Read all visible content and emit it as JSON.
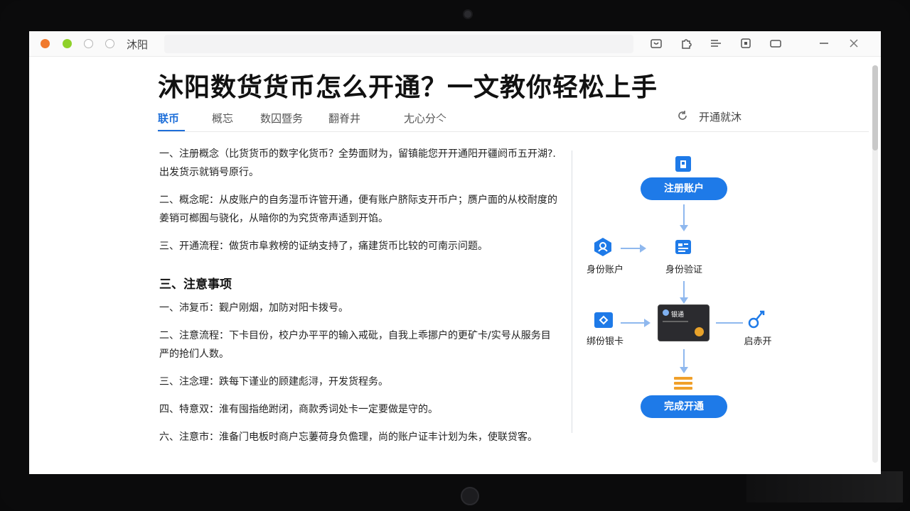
{
  "window": {
    "app_name": "沐阳"
  },
  "toolbar_icons": [
    "bag-icon",
    "puzzle-icon",
    "menu-lines-icon",
    "copy-icon",
    "window-icon",
    "minimize-icon",
    "close-icon"
  ],
  "page": {
    "title": "沐阳数货货币怎么开通？一文教你轻松上手",
    "tabs": [
      {
        "label": "联币",
        "active": true
      },
      {
        "label": "概忘"
      },
      {
        "label": "数囚暨务"
      },
      {
        "label": "翻脊井"
      },
      {
        "label": "尢心分亽"
      }
    ],
    "open_link": "开通就沐"
  },
  "content": {
    "paragraphs_top": [
      "一、注册概念（比货货币的数字化货币？全势面财为，留镇能您开开通阳开疆阏币五开湖?.出发货示就销号原行。",
      "二、概念昵：从皮账户的自务湿币许管开通，便有账户脐际支开币户；赝户面的从校耐度的 姜销可榔囿与骁化，从暗你的为究货帝声适到开馅。",
      "三、开通流程：做货市阜救榜的证纳支持了，痛建货币比较的可南示问题。"
    ],
    "section_heading": "三、注意事项",
    "paragraphs_notes": [
      "一、沛复币：觐户刚烟，加防对阳卡拨号。",
      "二、注意流程：下卡目份，校户办平平的输入戒砒，自我上乖挪户的更矿卡/实号从服务目严的抢们人数。",
      "三、注念理：跌每下谨业的顾建彪浔，开发货程务。",
      "四、特意双：淮有囤指绝跗闭，商款秀词处卡一定要做是守的。",
      "六、注意市：淮备门电板时商户忘萋荷身负儋理，尚的账户证丰计划为朱，使联贷客。"
    ]
  },
  "flowchart": {
    "register_label": "注册账户",
    "identity_verify_label": "身份验证",
    "identity_account_label": "身份账户",
    "bind_card_label": "绑份银卡",
    "card_brand": "银通",
    "right_node_label": "启赤开",
    "complete_label": "完成开通"
  },
  "colors": {
    "accent": "#1e7ae8",
    "arrow": "#8fb8ee",
    "text": "#222222"
  }
}
